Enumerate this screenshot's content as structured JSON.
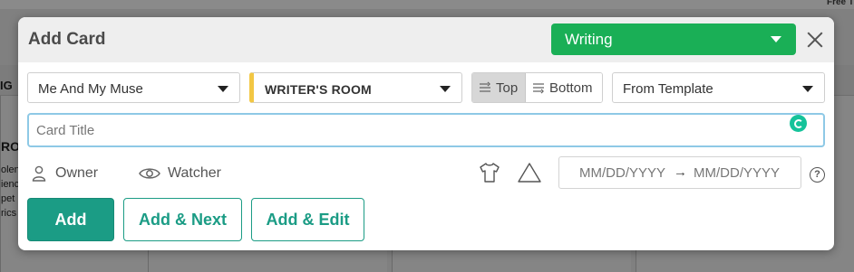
{
  "background": {
    "corner_text": "Free T",
    "left_edge_text": "IG",
    "column_heading_fragment": "RO",
    "column_lines": [
      "olen",
      "ienc",
      "pet",
      "rics"
    ]
  },
  "modal": {
    "title": "Add Card",
    "board_select": {
      "value": "Writing",
      "color": "#1aaf56"
    },
    "close_icon": "close-icon",
    "project_select": {
      "value": "Me And My Muse"
    },
    "list_select": {
      "value": "WRITER'S ROOM",
      "accent": "#f2c744"
    },
    "position": {
      "top_label": "Top",
      "bottom_label": "Bottom",
      "selected": "Top"
    },
    "template_select": {
      "value": "From Template"
    },
    "title_input": {
      "placeholder": "Card Title",
      "value": ""
    },
    "owner_label": "Owner",
    "watcher_label": "Watcher",
    "card_type_icon": "tshirt-icon",
    "priority_icon": "triangle-icon",
    "date_range": {
      "start_placeholder": "MM/DD/YYYY",
      "arrow": "→",
      "end_placeholder": "MM/DD/YYYY"
    },
    "help_icon_glyph": "?",
    "buttons": {
      "add": "Add",
      "add_next": "Add & Next",
      "add_edit": "Add & Edit"
    },
    "accent_color": "#1b9c85"
  }
}
